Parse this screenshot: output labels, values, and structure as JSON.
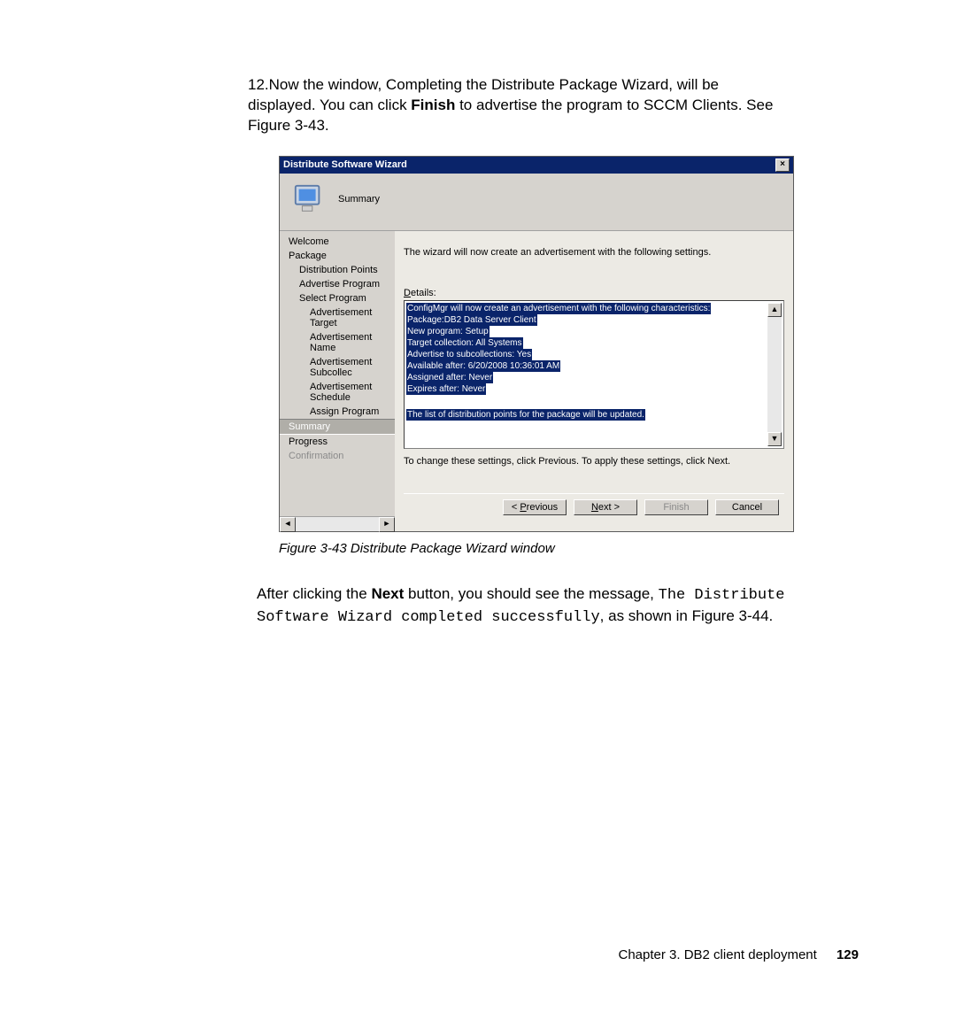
{
  "step": {
    "number": "12.",
    "text_before_bold": "Now the window, Completing the Distribute Package Wizard, will be displayed. You can click ",
    "bold": "Finish",
    "text_after_bold": " to advertise the program to SCCM Clients. See Figure 3-43."
  },
  "wizard": {
    "title": "Distribute Software Wizard",
    "header_label": "Summary",
    "sidebar": {
      "welcome": "Welcome",
      "package": "Package",
      "dist_points": "Distribution Points",
      "adv_program": "Advertise Program",
      "select_program": "Select Program",
      "adv_target": "Advertisement Target",
      "adv_name": "Advertisement Name",
      "adv_subcollec": "Advertisement Subcollec",
      "adv_schedule": "Advertisement Schedule",
      "assign_program": "Assign Program",
      "summary": "Summary",
      "progress": "Progress",
      "confirmation": "Confirmation"
    },
    "intro": "The wizard will now create an advertisement with the following settings.",
    "details_label": "Details:",
    "details": {
      "l1": "ConfigMgr will now create an advertisement with the following characteristics:",
      "l2": "Package:DB2 Data Server Client",
      "l3": "New program: Setup",
      "l4": "Target collection: All Systems",
      "l5": "Advertise to subcollections: Yes",
      "l6": "Available after: 6/20/2008 10:36:01 AM",
      "l7": "Assigned after: Never",
      "l8": "Expires after: Never",
      "l9": "The list of distribution points for the package will be updated."
    },
    "hint": "To change these settings, click Previous. To apply these settings, click Next.",
    "buttons": {
      "previous": "Previous",
      "next": "Next >",
      "finish": "Finish",
      "cancel": "Cancel"
    }
  },
  "caption": "Figure 3-43   Distribute Package Wizard window",
  "para2": {
    "t1": "After clicking the ",
    "b1": "Next",
    "t2": " button, you should see the message, ",
    "m1": "The Distribute Software Wizard completed successfully",
    "t3": ", as shown in Figure 3-44."
  },
  "footer": {
    "chapter": "Chapter 3. DB2 client deployment",
    "page": "129"
  }
}
